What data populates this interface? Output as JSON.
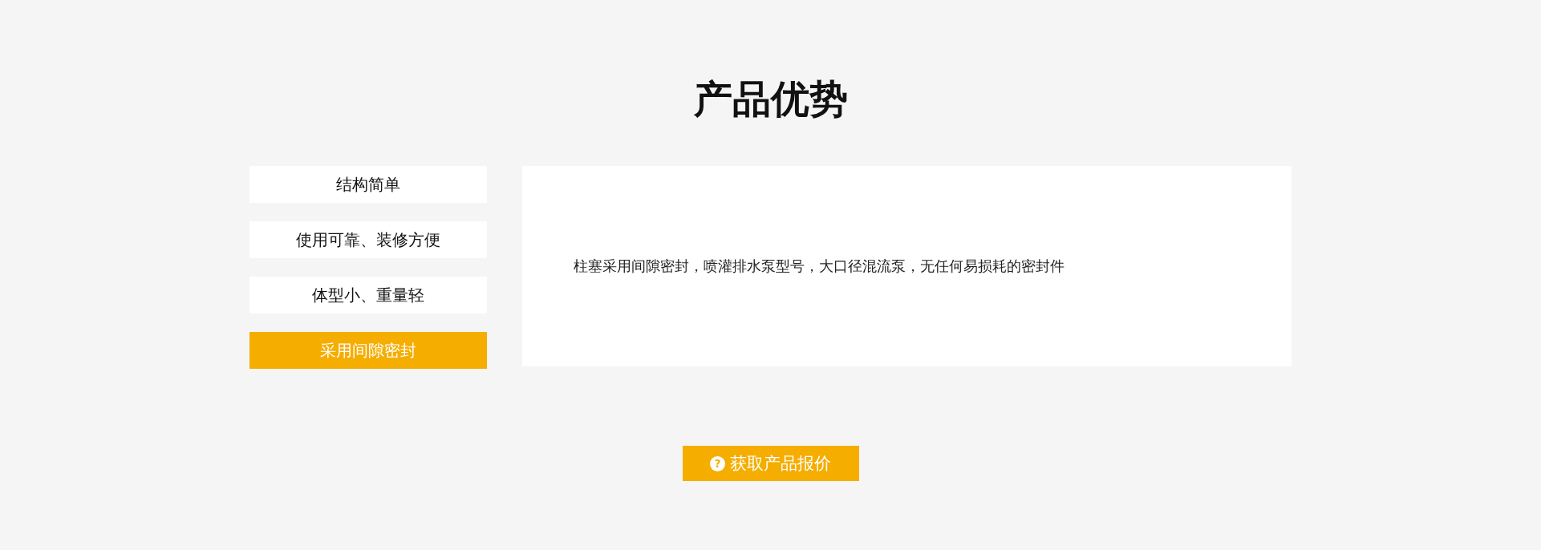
{
  "title": "产品优势",
  "tabs": [
    {
      "label": "结构简单",
      "selected": false
    },
    {
      "label": "使用可靠、装修方便",
      "selected": false
    },
    {
      "label": "体型小、重量轻",
      "selected": false
    },
    {
      "label": "采用间隙密封",
      "selected": true
    }
  ],
  "panel": {
    "text": "柱塞采用间隙密封，喷灌排水泵型号，大口径混流泵，无任何易损耗的密封件"
  },
  "quote_button": {
    "label": "获取产品报价",
    "icon": "?"
  }
}
